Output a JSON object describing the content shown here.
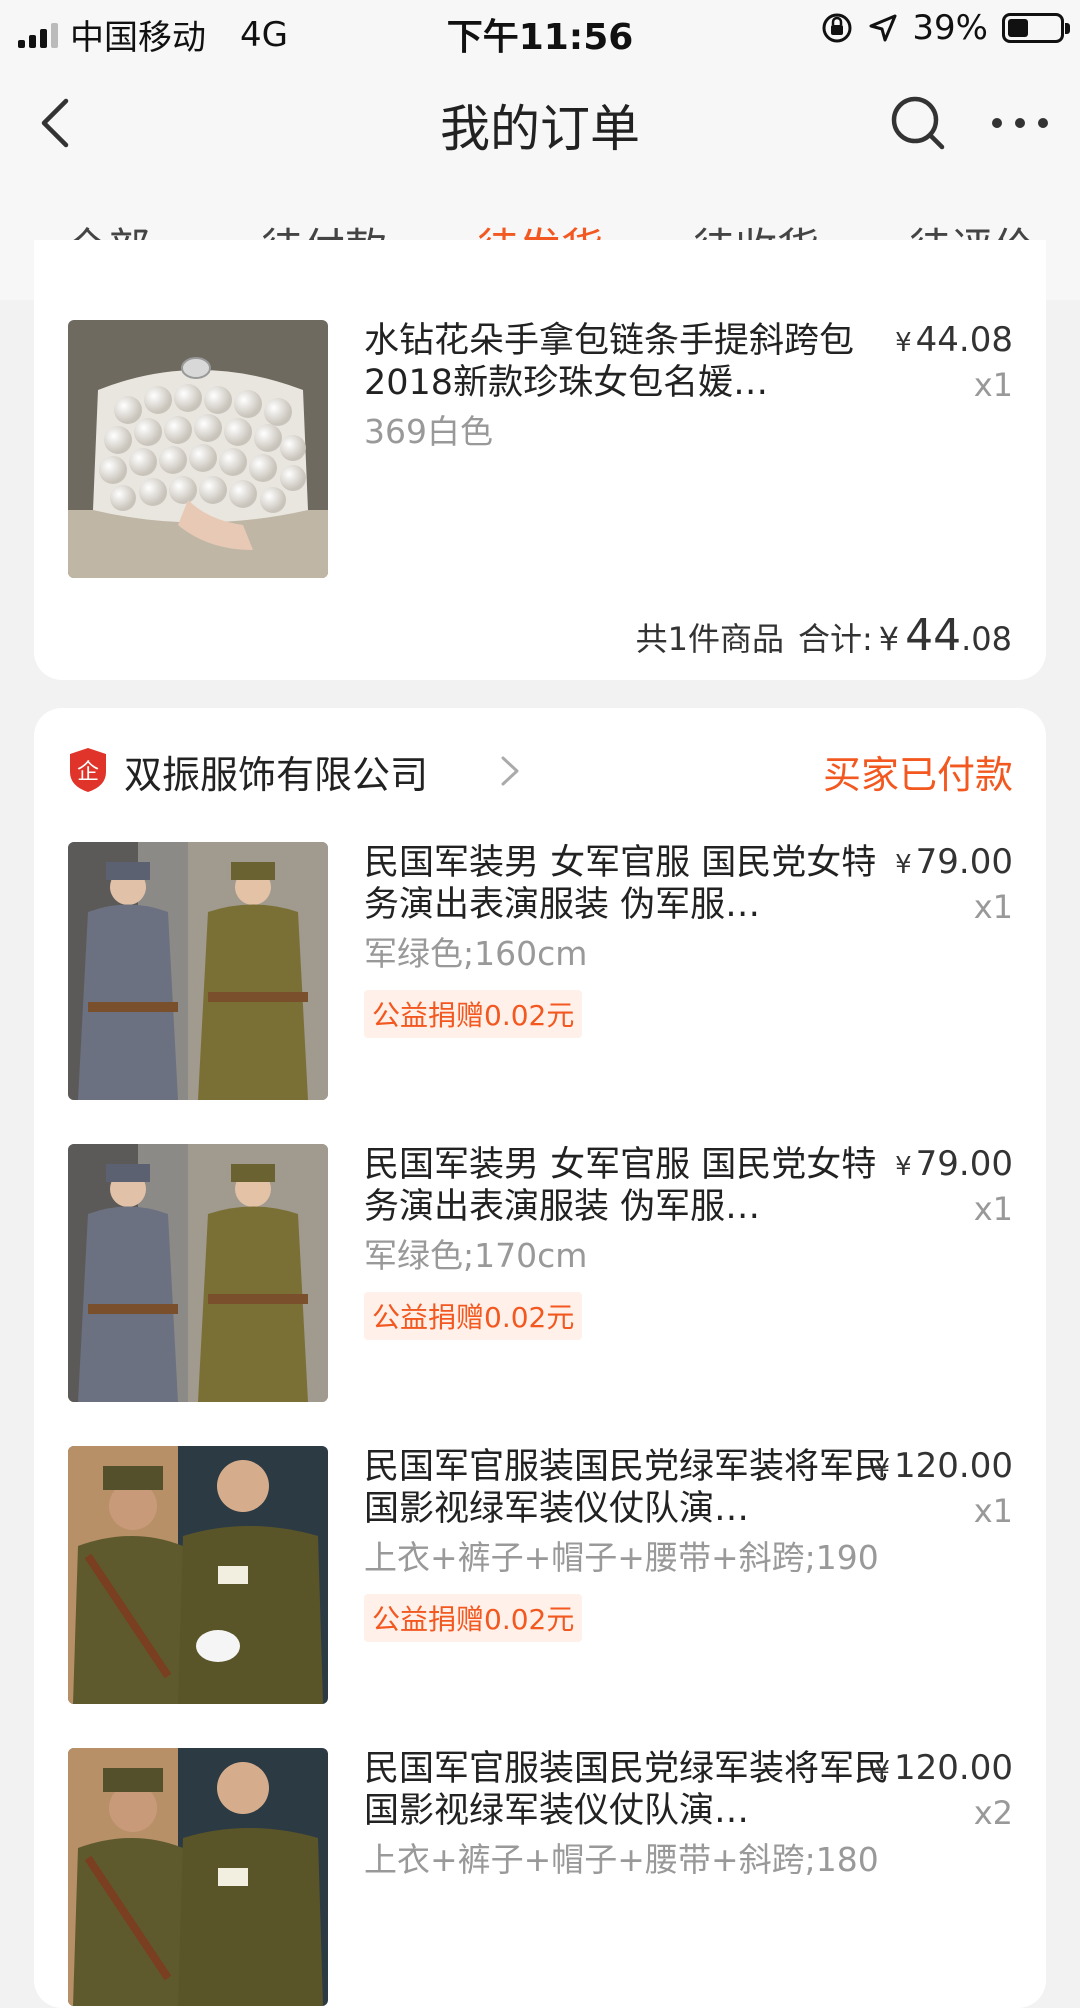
{
  "status_bar": {
    "carrier": "中国移动",
    "network": "4G",
    "time": "下午11:56",
    "battery": "39%",
    "battery_level": 0.39
  },
  "nav": {
    "title": "我的订单"
  },
  "tabs": [
    {
      "label": "全部",
      "active": false
    },
    {
      "label": "待付款",
      "active": false
    },
    {
      "label": "待发货",
      "active": true
    },
    {
      "label": "待收货",
      "active": false
    },
    {
      "label": "待评价",
      "active": false
    }
  ],
  "order1": {
    "item": {
      "name": "水钻花朵手拿包链条手提斜跨包2018新款珍珠女包名媛…",
      "sku": "369白色",
      "price": "44.08",
      "qty": "x1"
    },
    "total": {
      "count_label": "共1件商品",
      "sum_label": "合计:",
      "currency": "¥",
      "int": "44",
      "dec": ".08"
    }
  },
  "order2": {
    "shop_name": "双振服饰有限公司",
    "status": "买家已付款",
    "badge_text": "企",
    "items": [
      {
        "name": "民国军装男 女军官服 国民党女特务演出表演服装 伪军服…",
        "sku": "军绿色;160cm",
        "tag": "公益捐赠0.02元",
        "price": "79.00",
        "qty": "x1"
      },
      {
        "name": "民国军装男 女军官服 国民党女特务演出表演服装 伪军服…",
        "sku": "军绿色;170cm",
        "tag": "公益捐赠0.02元",
        "price": "79.00",
        "qty": "x1"
      },
      {
        "name": "民国军官服装国民党绿军装将军民国影视绿军装仪仗队演…",
        "sku": "上衣+裤子+帽子+腰带+斜跨;190",
        "tag": "公益捐赠0.02元",
        "price": "120.00",
        "qty": "x1"
      },
      {
        "name": "民国军官服装国民党绿军装将军民国影视绿军装仪仗队演…",
        "sku": "上衣+裤子+帽子+腰带+斜跨;180",
        "tag": "",
        "price": "120.00",
        "qty": "x2"
      }
    ]
  },
  "currency_symbol": "¥",
  "colors": {
    "accent": "#f2581f",
    "background": "#f2f2f2",
    "card": "#ffffff"
  }
}
